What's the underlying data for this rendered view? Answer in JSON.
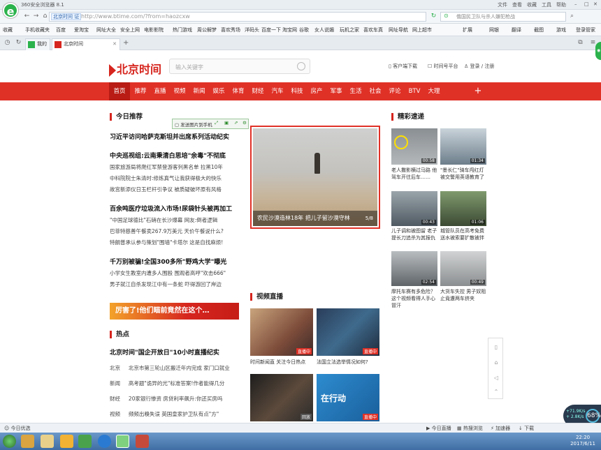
{
  "browser": {
    "title": "360安全浏览器 8.1",
    "title_menu": [
      "文件",
      "查看",
      "收藏",
      "工具",
      "帮助"
    ],
    "site_badge": "北京时间 证",
    "url": "http://www.btime.com/?from=haozcxw",
    "search_query": "俄国民卫队与杀人嫌犯枪战",
    "bookmarks": [
      "收藏",
      "手机收藏夹",
      "百度",
      "爱淘宝",
      "网址大全",
      "安全上网",
      "电影影院",
      "热门游戏",
      "周公解梦",
      "喜欢秀场",
      "洋码头",
      "百度一下",
      "淘宝网",
      "谷歌",
      "女人说媚",
      "玩机之家",
      "喜欢车真",
      "网址导航",
      "网上超市"
    ],
    "bookmarks_right": [
      "扩展",
      "网银",
      "翻译",
      "截图",
      "游戏",
      "登录管家"
    ],
    "tabs": [
      {
        "label": "我的首页"
      },
      {
        "label": "北京时间"
      }
    ],
    "new_tab_label": "+",
    "status_left": "今日优选",
    "status_right": [
      "今日直播",
      "热搜浏览",
      "加速器",
      "下载"
    ],
    "net_up": "+71.9K/s",
    "net_down": "+ 2.8K/s",
    "net_pct": "68%",
    "clock_time": "22:20",
    "clock_date": "2017/6/11"
  },
  "site": {
    "logo": "北京时间",
    "search_placeholder": "输入关键字",
    "top_links": [
      "客户端下载",
      "时间号平台",
      "登录 / 注册"
    ],
    "nav": [
      "首页",
      "推荐",
      "直播",
      "视频",
      "新闻",
      "娱乐",
      "体育",
      "财经",
      "汽车",
      "科技",
      "房产",
      "军事",
      "生活",
      "社会",
      "评论",
      "BTV",
      "大理"
    ],
    "nav_plus": "+"
  },
  "today": {
    "heading": "今日推荐",
    "stories": [
      {
        "headline": "习近平访问哈萨克斯坦并出席系列活动纪实",
        "subs": []
      },
      {
        "headline": "中央巡视组:云南秉清白思培\"余毒\"不彻底",
        "subs": [
          "国家旅游局将爬红军禁登游客列黑名单 拉黑10年",
          "中科院院士朱清时:修炼真气让我获得极大的快乐",
          "故宫新添仪日玉栏杆引争议 被质疑破坏原有风格"
        ]
      },
      {
        "headline": "百余吨医疗垃圾流入市场!尿袋针头被再加工",
        "subs": [
          "\"中国足球德比\"石硝在长沙爆幕 网友:倒者逻辑",
          "巴菲特慈善午餐卖267.9万美元 天价午餐说什么?",
          "特朗普承认参与策划\"围墙\"卡塔尔 这是自找麻烦!"
        ]
      },
      {
        "headline": "千万别被骗!全国300多所\"野鸡大学\"曝光",
        "subs": [
          "小学女生教室内遭多人围殴 围观者高呼\"欢击666\"",
          "男子就江自杀发现江中有一条蛇 吓得游回了岸边"
        ]
      }
    ],
    "banner": "厉害了!他们瞄前竟然在这个…",
    "float_toolbar": "发送图片到手机"
  },
  "hero": {
    "caption": "农民沙漠造林18年 把儿子留沙漠守林",
    "page": "5/8"
  },
  "hot": {
    "heading": "热点",
    "headline": "北京时间\"国企开放日\"10小时直播纪实",
    "rows": [
      {
        "cat": "北京",
        "text": "北京市第三轮山区搬迁年内完成 家门口就业"
      },
      {
        "cat": "新闻",
        "text": "高考题\"诡异的光\"标准答案!作者能得几分"
      },
      {
        "cat": "财经",
        "text": "20家银行惨资 房贷利率飙升:你还买房吗"
      },
      {
        "cat": "视频",
        "text": "频频出糗失误 英国皇家护卫队有点\"方\""
      }
    ]
  },
  "live": {
    "heading": "视频直播",
    "items": [
      {
        "caption": "时间新闻直 关注今日热点",
        "badge": "直播中"
      },
      {
        "caption": "法国立法选举情况如何?",
        "badge": "直播中"
      },
      {
        "caption": "",
        "badge": "回放"
      },
      {
        "caption": "",
        "badge": "直播中"
      }
    ],
    "thumb_text_4": "在行动"
  },
  "wonderful": {
    "heading": "精彩速递",
    "items": [
      {
        "duration": "00:58",
        "caption": "老人撒影横过马路 他驾车开往后车……"
      },
      {
        "duration": "01:34",
        "caption": "\"墨长仁\"骑车闯红灯被交警用英语教育了"
      },
      {
        "duration": "00:43",
        "caption": "儿子调和被图留 老子提长刀追杀为其报仇"
      },
      {
        "duration": "01:06",
        "caption": "城管队员在高考免费送水被索要扩散被拌"
      },
      {
        "duration": "02:54",
        "caption": "摩托车赛有多危险？这个视频看得人手心冒汗"
      },
      {
        "duration": "00:49",
        "caption": "大货车失控 男子奴阻止竟遭两车挤夹"
      }
    ]
  }
}
